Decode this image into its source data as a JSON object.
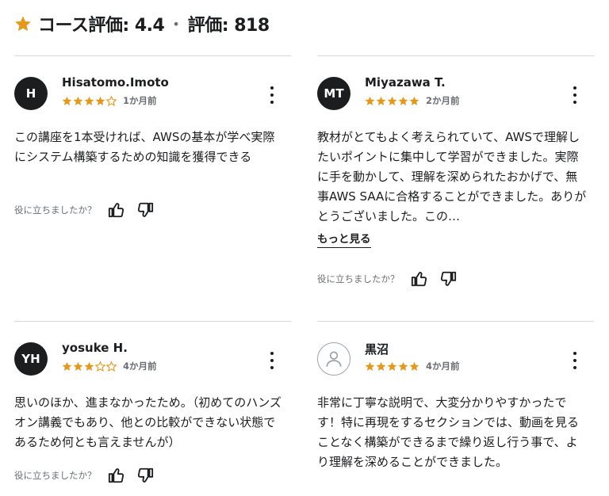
{
  "header": {
    "rating_label": "コース評価: 4.4",
    "separator": "•",
    "count_label": "評価: 818"
  },
  "helpful_label": "役に立ちましたか？",
  "colors": {
    "star": "#e59819",
    "text": "#1c1d1f",
    "muted": "#6a6f73",
    "divider": "#d1d7dc"
  },
  "reviews": [
    {
      "initials": "H",
      "name": "Hisatomo.Imoto",
      "rating": 4,
      "ago": "1か月前",
      "text": "この講座を1本受ければ、AWSの基本が学べ実際にシステム構築するための知識を獲得できる"
    },
    {
      "initials": "MT",
      "name": "Miyazawa T.",
      "rating": 5,
      "ago": "2か月前",
      "text": "教材がとてもよく考えられていて、AWSで理解したいポイントに集中して学習ができました。実際に手を動かして、理解を深められたおかげで、無事AWS SAAに合格することができました。ありがとうございました。この…",
      "more": "もっと見る"
    },
    {
      "initials": "YH",
      "name": "yosuke H.",
      "rating": 3,
      "ago": "4か月前",
      "text": "思いのほか、進まなかったため。（初めてのハンズオン講義でもあり、他との比較ができない状態であるため何とも言えませんが）"
    },
    {
      "initials": "",
      "name": "黒沼",
      "rating": 5,
      "ago": "4か月前",
      "text": "非常に丁寧な説明で、大変分かりやすかったです！特に再現をするセクションでは、動画を見ることなく構築ができるまで繰り返し行う事で、より理解を深めることができました。"
    }
  ]
}
